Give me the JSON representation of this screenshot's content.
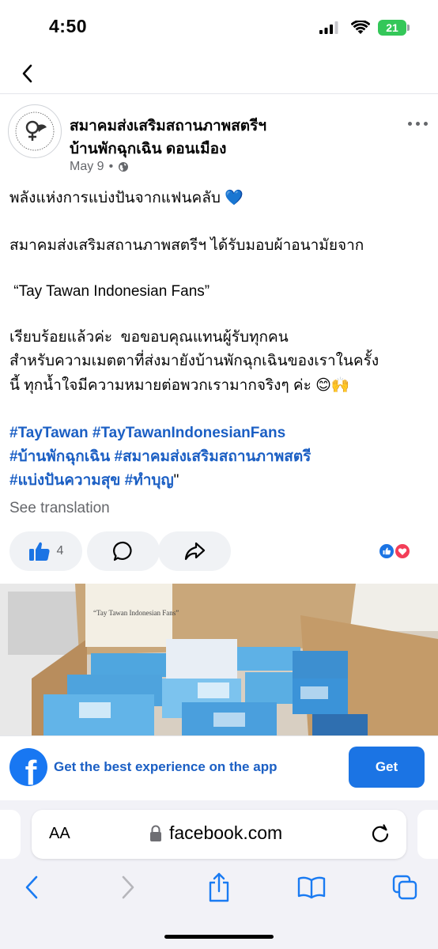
{
  "status_bar": {
    "time": "4:50",
    "battery": "21"
  },
  "post": {
    "page_name_line1": "สมาคมส่งเสริมสถานภาพสตรีฯ",
    "page_name_line2": "บ้านพักฉุกเฉิน ดอนเมือง",
    "date": "May 9",
    "visibility_icon": "globe-icon",
    "lines": {
      "l1": "พลังแห่งการแบ่งปันจากแฟนคลับ 💙",
      "l2": "สมาคมส่งเสริมสถานภาพสตรีฯ ได้รับมอบผ้าอนามัยจาก",
      "l3": " “Tay Tawan Indonesian Fans”",
      "l4": "เรียบร้อยแล้วค่ะ  ขอขอบคุณแทนผู้รับทุกคน",
      "l5": "สำหรับความเมตตาที่ส่งมายังบ้านพักฉุกเฉินของเราในครั้ง",
      "l6": "นี้ ทุกน้ำใจมีความหมายต่อพวกเรามากจริงๆ ค่ะ 😊🙌"
    },
    "hashtags": {
      "h1": "#TayTawan #TayTawanIndonesianFans",
      "h2": "#บ้านพักฉุกเฉิน #สมาคมส่งเสริมสถานภาพสตรี",
      "h3": "#แบ่งปันความสุข #ทำบุญ",
      "h3_tail": "\""
    },
    "see_translation": "See translation",
    "like_count": "4",
    "photo_note": "“Tay Tawan Indonesian Fans”"
  },
  "app_banner": {
    "text": "Get the best experience on the app",
    "button": "Get"
  },
  "safari": {
    "aa_label": "AA",
    "url": "facebook.com"
  },
  "colors": {
    "fb_blue": "#1877f2",
    "hashtag_blue": "#1b5fc4",
    "like_blue": "#1b74e4",
    "battery_green": "#34c759"
  }
}
